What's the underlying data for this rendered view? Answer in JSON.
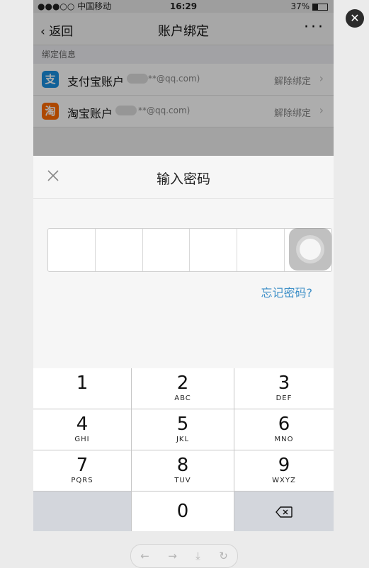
{
  "status_bar": {
    "carrier": "●●●○○ 中国移动",
    "time": "16:29",
    "battery": "37%",
    "battery_level": 0.37
  },
  "nav": {
    "back_label": "返回",
    "title": "账户绑定",
    "more_label": "···"
  },
  "bindings": {
    "section_label": "绑定信息",
    "accounts": [
      {
        "icon_text": "支",
        "name": "支付宝账户",
        "email": "**@qq.com)",
        "action": "解除绑定",
        "color": "#1a8fe0"
      },
      {
        "icon_text": "淘",
        "name": "淘宝账户",
        "email": "**@qq.com)",
        "action": "解除绑定",
        "color": "#ff6a00"
      }
    ]
  },
  "sheet": {
    "title": "输入密码",
    "forgot_link": "忘记密码?"
  },
  "keypad": {
    "keys": [
      {
        "num": "1",
        "letters": ""
      },
      {
        "num": "2",
        "letters": "ABC"
      },
      {
        "num": "3",
        "letters": "DEF"
      },
      {
        "num": "4",
        "letters": "GHI"
      },
      {
        "num": "5",
        "letters": "JKL"
      },
      {
        "num": "6",
        "letters": "MNO"
      },
      {
        "num": "7",
        "letters": "PQRS"
      },
      {
        "num": "8",
        "letters": "TUV"
      },
      {
        "num": "9",
        "letters": "WXYZ"
      },
      {
        "num": "0",
        "letters": ""
      }
    ]
  },
  "overlay": {
    "close_label": "✕"
  },
  "browser_toolbar": {
    "back": "←",
    "forward": "→",
    "download": "⤓",
    "refresh": "↻"
  }
}
